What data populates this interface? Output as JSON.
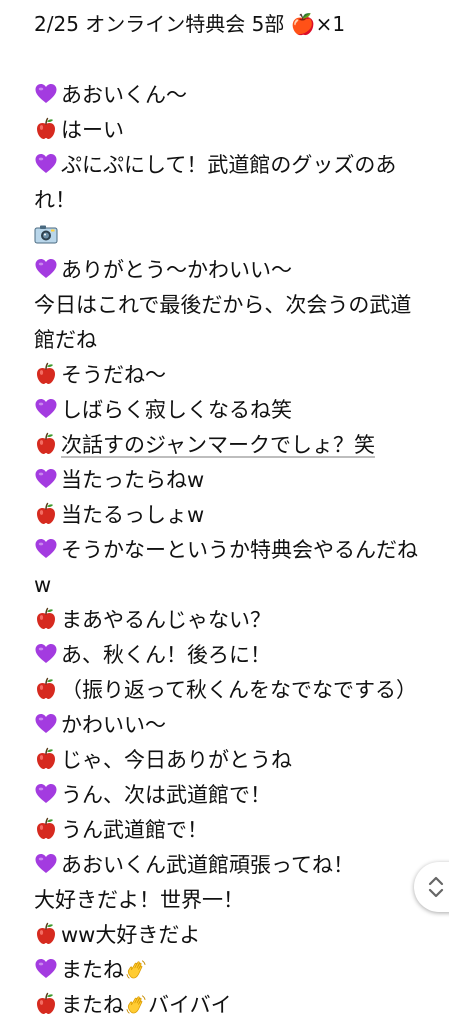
{
  "note": {
    "title": "2/25 オンライン特典会 5部 🍎×1",
    "lines": [
      {
        "icon": "heart",
        "text": "あおいくん～"
      },
      {
        "icon": "apple",
        "text": "はーい"
      },
      {
        "icon": "heart",
        "text": "ぷにぷにして！武道館のグッズのあれ！"
      },
      {
        "icon": "camera",
        "text": ""
      },
      {
        "icon": "heart",
        "text": "ありがとう～かわいい～"
      },
      {
        "icon": "",
        "text": "今日はこれで最後だから、次会うの武道館だね"
      },
      {
        "icon": "apple",
        "text": "そうだね～"
      },
      {
        "icon": "heart",
        "text": "しばらく寂しくなるね笑"
      },
      {
        "icon": "apple",
        "text": "次話すのジャンマークでしょ？笑"
      },
      {
        "icon": "heart",
        "text": "当たったらねw"
      },
      {
        "icon": "apple",
        "text": "当たるっしょw"
      },
      {
        "icon": "heart",
        "text": "そうかなーというか特典会やるんだねw"
      },
      {
        "icon": "apple",
        "text": "まあやるんじゃない？"
      },
      {
        "icon": "heart",
        "text": "あ、秋くん！後ろに！"
      },
      {
        "icon": "apple",
        "text": "（振り返って秋くんをなでなでする）"
      },
      {
        "icon": "heart",
        "text": "かわいい～"
      },
      {
        "icon": "apple",
        "text": "じゃ、今日ありがとうね"
      },
      {
        "icon": "heart",
        "text": "うん、次は武道館で！"
      },
      {
        "icon": "apple",
        "text": "うん武道館で！"
      },
      {
        "icon": "heart",
        "text": "あおいくん武道館頑張ってね！"
      },
      {
        "icon": "",
        "text": "大好きだよ！世界一！"
      },
      {
        "icon": "apple",
        "text": "ww大好きだよ"
      },
      {
        "icon": "heart",
        "text": "またね",
        "suffix_icon": "wave"
      },
      {
        "icon": "apple",
        "text": "またね",
        "suffix_icon": "wave",
        "after": "バイバイ"
      }
    ]
  },
  "icons": {
    "heart": "purple-heart-icon",
    "apple": "red-apple-icon",
    "camera": "camera-icon",
    "wave": "waving-hand-icon",
    "scroll": "up-down-chevron-icon"
  },
  "colors": {
    "heart": "#a33be0",
    "apple": "#d62a1f",
    "text": "#111111",
    "background": "#ffffff"
  }
}
